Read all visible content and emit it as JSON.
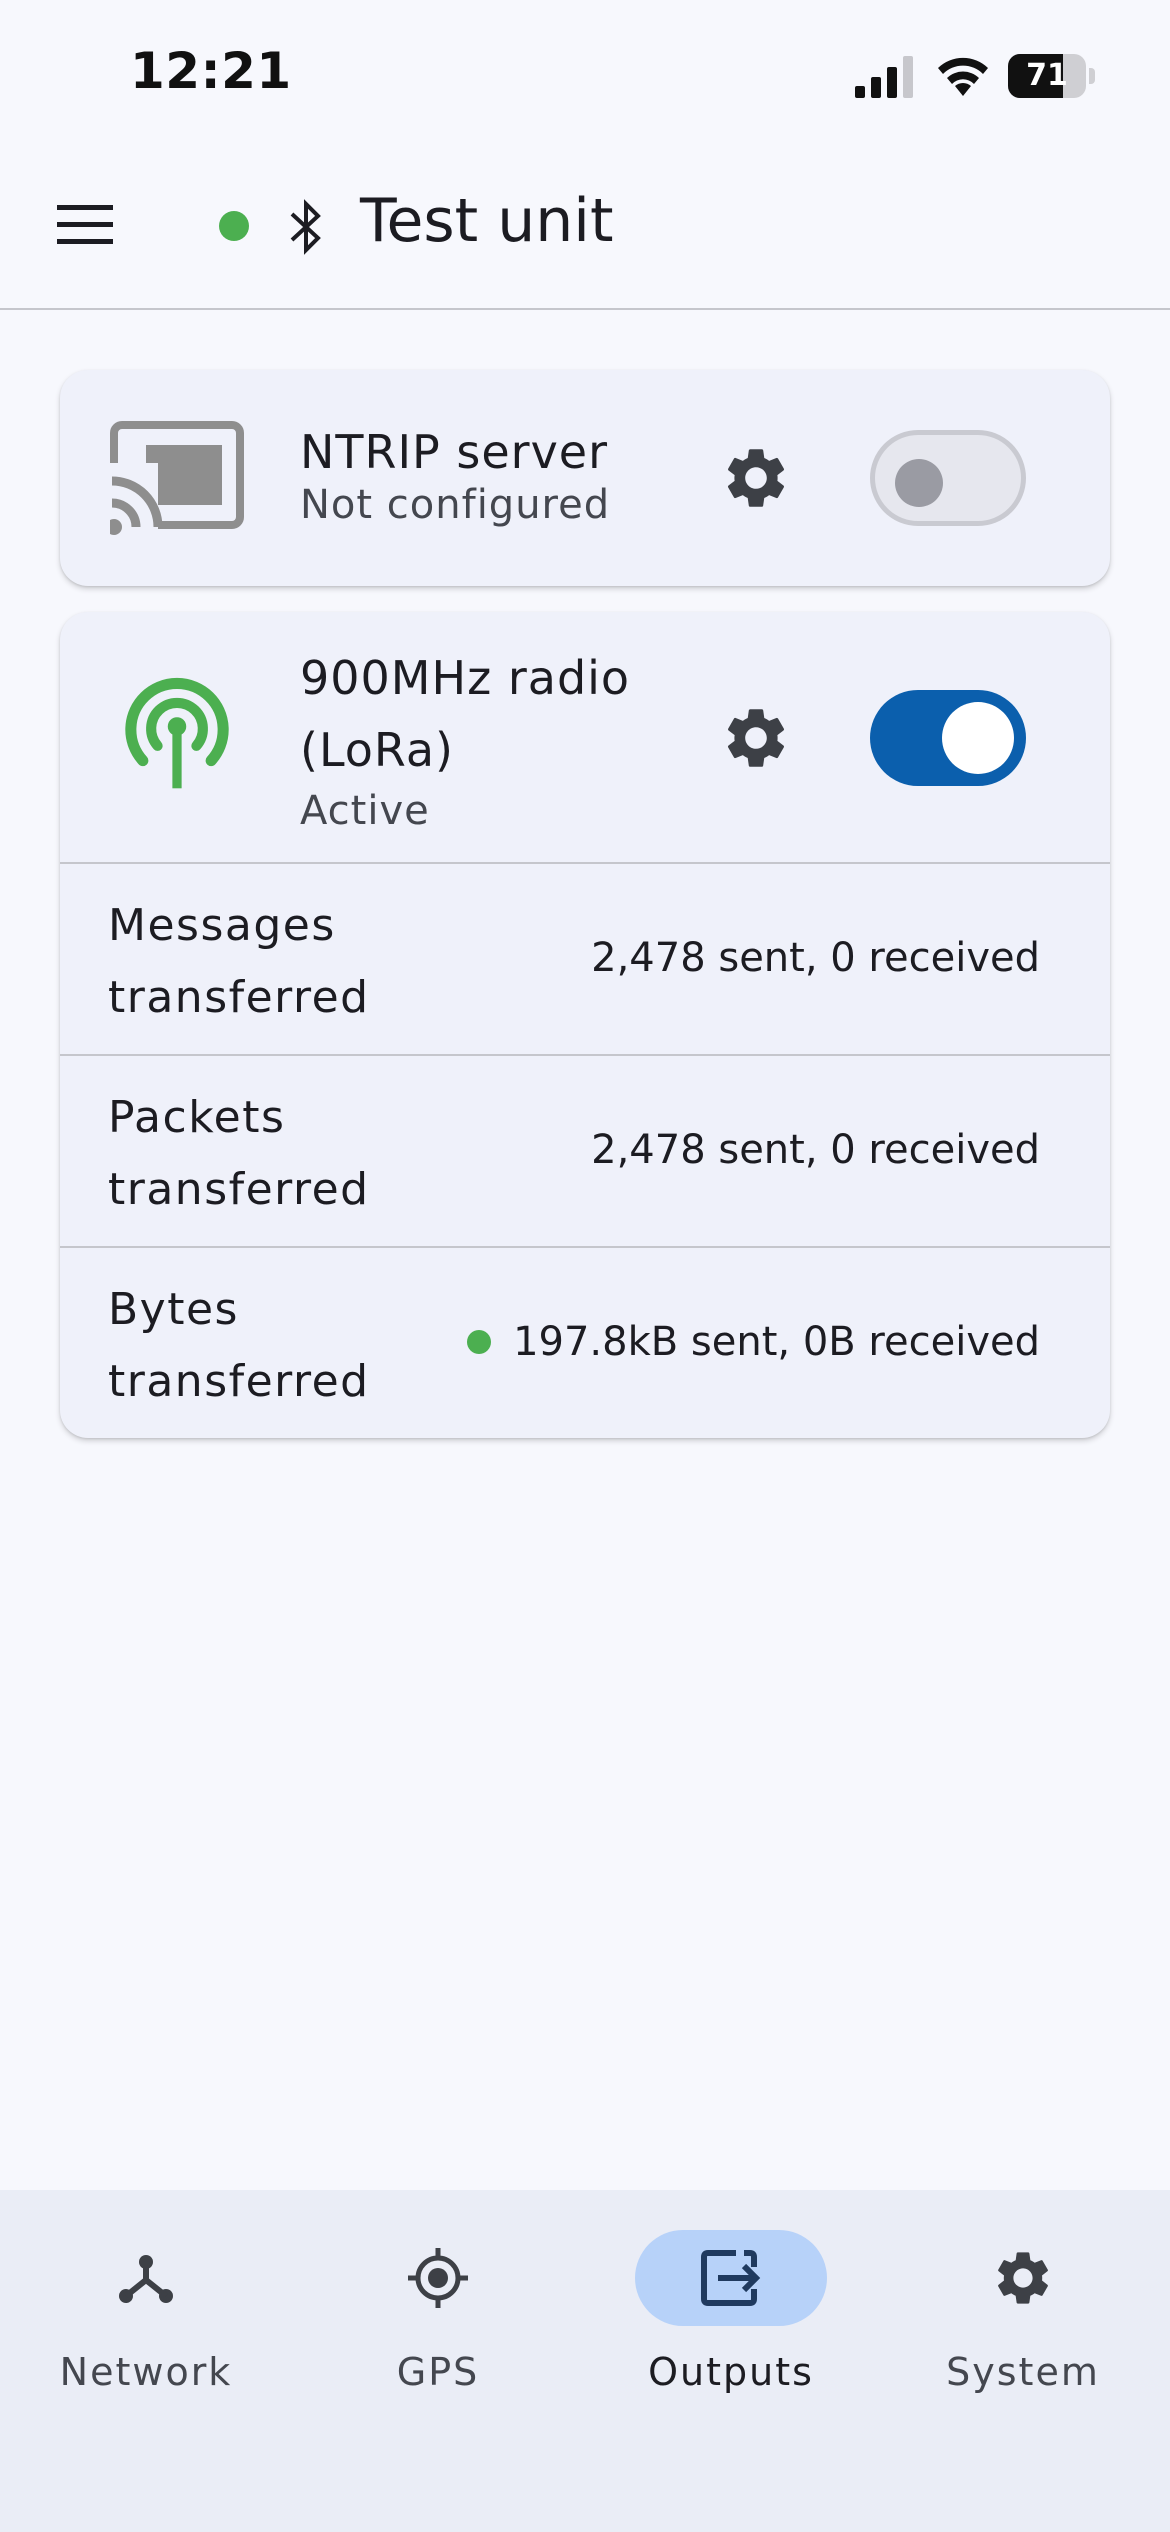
{
  "status_bar": {
    "time": "12:21",
    "battery": "71",
    "battery_level": 0.71
  },
  "app_bar": {
    "device_name": "Test unit",
    "connection_color": "#4caf50"
  },
  "outputs": [
    {
      "title": "NTRIP server",
      "status": "Not configured",
      "enabled": false,
      "icon": "cast-icon"
    },
    {
      "title": "900MHz radio (LoRa)",
      "status": "Active",
      "enabled": true,
      "icon": "antenna-icon",
      "stats": [
        {
          "label": "Messages transferred",
          "value": "2,478 sent, 0 received"
        },
        {
          "label": "Packets transferred",
          "value": "2,478 sent, 0 received"
        },
        {
          "label": "Bytes transferred",
          "value": "197.8kB sent, 0B received"
        }
      ]
    }
  ],
  "nav": [
    {
      "label": "Network",
      "icon": "network-icon"
    },
    {
      "label": "GPS",
      "icon": "gps-icon"
    },
    {
      "label": "Outputs",
      "icon": "outputs-icon",
      "active": true
    },
    {
      "label": "System",
      "icon": "gear-icon"
    }
  ],
  "colors": {
    "accent": "#0b5fad",
    "active": "#4caf50",
    "nav_pill": "#b7d2f9"
  }
}
